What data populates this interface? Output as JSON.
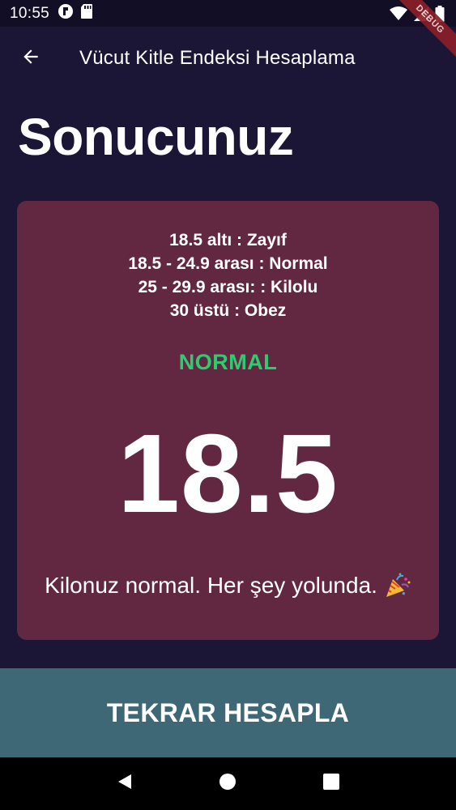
{
  "status_bar": {
    "time": "10:55",
    "debug_banner": "DEBUG"
  },
  "app_bar": {
    "title": "Vücut Kitle Endeksi Hesaplama",
    "back_icon": "arrow-left-icon"
  },
  "page": {
    "title": "Sonucunuz"
  },
  "result_card": {
    "ranges": [
      "18.5 altı : Zayıf",
      "18.5 - 24.9 arası : Normal",
      "25 - 29.9 arası: : Kilolu",
      "30 üstü : Obez"
    ],
    "status": "NORMAL",
    "status_color": "#2ecc71",
    "bmi": "18.5",
    "comment": "Kilonuz normal. Her şey yolunda.",
    "comment_icon": "party-popper-icon",
    "card_color": "#622842"
  },
  "recalc_button": {
    "label": "TEKRAR HESAPLA",
    "color": "#3f6877"
  },
  "colors": {
    "background": "#1b1636",
    "status_bar": "#110e26"
  }
}
